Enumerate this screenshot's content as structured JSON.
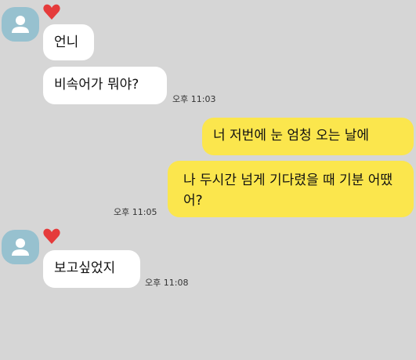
{
  "colors": {
    "background": "#d6d6d6",
    "incoming_bubble": "#ffffff",
    "outgoing_bubble": "#fbe64d",
    "avatar": "#97c1cf",
    "heart": "#e53b3b"
  },
  "icons": {
    "avatar": "default-person-avatar-icon",
    "reaction": "heart-icon"
  },
  "messages": [
    {
      "sender": "other",
      "text": "언니"
    },
    {
      "sender": "other",
      "text": "비속어가 뭐야?",
      "time": "오후 11:03"
    },
    {
      "sender": "me",
      "text": "너 저번에 눈 엄청 오는 날에"
    },
    {
      "sender": "me",
      "text": "나 두시간 넘게 기다렸을 때 기분 어땠어?",
      "time": "오후 11:05"
    },
    {
      "sender": "other",
      "text": "보고싶었지",
      "time": "오후 11:08"
    }
  ]
}
